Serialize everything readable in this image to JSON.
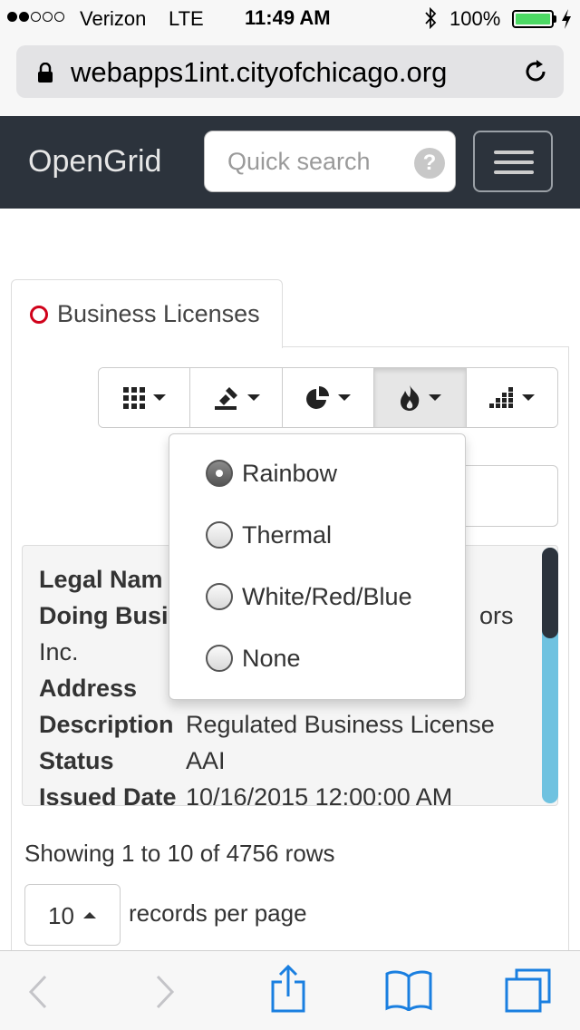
{
  "status_bar": {
    "carrier": "Verizon",
    "network": "LTE",
    "time": "11:49 AM",
    "battery": "100%",
    "battery_color": "#4cd964"
  },
  "browser": {
    "url": "webapps1int.cityofchicago.org"
  },
  "navbar": {
    "brand": "OpenGrid",
    "search_placeholder": "Quick search",
    "help_glyph": "?"
  },
  "tab": {
    "label": "Business Licenses",
    "ring_color": "#d0021b"
  },
  "toolbar": {
    "buttons": [
      {
        "icon": "grid-icon"
      },
      {
        "icon": "stamp-icon"
      },
      {
        "icon": "pie-chart-icon"
      },
      {
        "icon": "fire-icon",
        "active": true
      },
      {
        "icon": "bar-chart-icon"
      }
    ]
  },
  "heatmap_menu": {
    "options": [
      {
        "label": "Rainbow",
        "checked": true
      },
      {
        "label": "Thermal",
        "checked": false
      },
      {
        "label": "White/Red/Blue",
        "checked": false
      },
      {
        "label": "None",
        "checked": false
      }
    ]
  },
  "record": {
    "legal_name_label": "Legal Nam",
    "doing_business_label": "Doing Busi",
    "doing_business_value_tail": "ors",
    "doing_business_value_line2": "Inc.",
    "address_label": "Address",
    "description_label": "Description",
    "description_value": "Regulated Business License",
    "status_label": "Status",
    "status_value": "AAI",
    "issued_date_label": "Issued Date",
    "issued_date_value": "10/16/2015 12:00:00 AM"
  },
  "paging": {
    "showing": "Showing 1 to 10 of 4756 rows",
    "page_size": "10",
    "per_page_label": "records per page"
  },
  "accent_color": "#2c333c",
  "scrollbar_color": "#6fc2e0"
}
